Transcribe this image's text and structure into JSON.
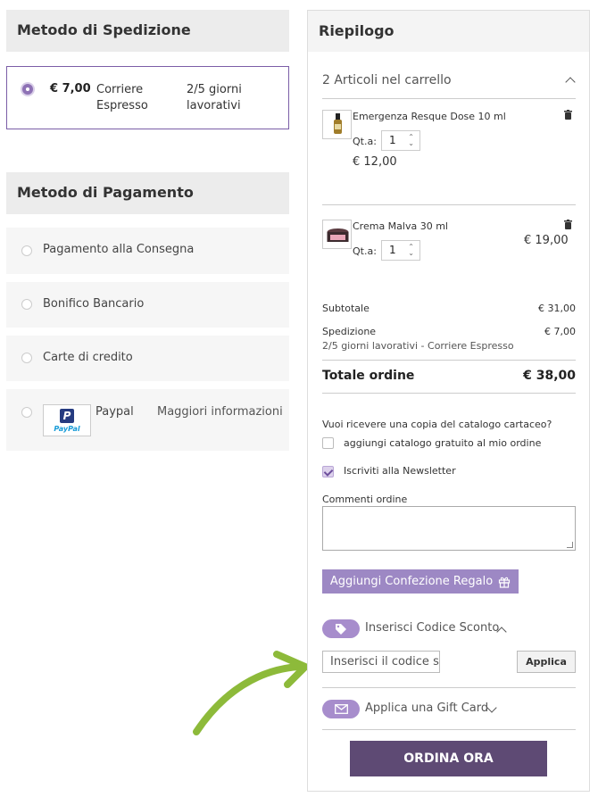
{
  "shipping": {
    "title": "Metodo di Spedizione",
    "option": {
      "price": "€ 7,00",
      "carrier": "Corriere Espresso",
      "time": "2/5 giorni lavorativi"
    }
  },
  "payment": {
    "title": "Metodo di Pagamento",
    "options": [
      {
        "label": "Pagamento alla Consegna"
      },
      {
        "label": "Bonifico Bancario"
      },
      {
        "label": "Carte di credito"
      },
      {
        "label": "Paypal",
        "logo": "PayPal",
        "more": "Maggiori informazioni"
      }
    ]
  },
  "summary": {
    "title": "Riepilogo",
    "cart_count": "2 Articoli nel carrello",
    "items": [
      {
        "name": "Emergenza Resque Dose 10 ml",
        "qty_label": "Qt.a:",
        "qty": "1",
        "price": "€ 12,00"
      },
      {
        "name": "Crema Malva 30 ml",
        "qty_label": "Qt.a:",
        "qty": "1",
        "price": "€ 19,00"
      }
    ],
    "subtotal_label": "Subtotale",
    "subtotal_value": "€ 31,00",
    "shipping_label": "Spedizione",
    "shipping_value": "€ 7,00",
    "shipping_detail": "2/5 giorni lavorativi - Corriere Espresso",
    "total_label": "Totale ordine",
    "total_value": "€ 38,00",
    "catalog_question": "Vuoi ricevere una copia del catalogo cartaceo?",
    "catalog_checkbox": "aggiungi catalogo gratuito al mio ordine",
    "newsletter_checkbox": "Iscriviti alla Newsletter",
    "comments_label": "Commenti ordine",
    "gift_wrap_button": "Aggiungi Confezione Regalo",
    "discount_label": "Inserisci Codice Sconto",
    "discount_placeholder": "Inserisci il codice sc",
    "apply_button": "Applica",
    "giftcard_label": "Applica una Gift Card",
    "order_button": "ORDINA ORA"
  },
  "colors": {
    "accent": "#9d88c4",
    "order_button": "#5e4a74",
    "arrow": "#8dba3a"
  }
}
